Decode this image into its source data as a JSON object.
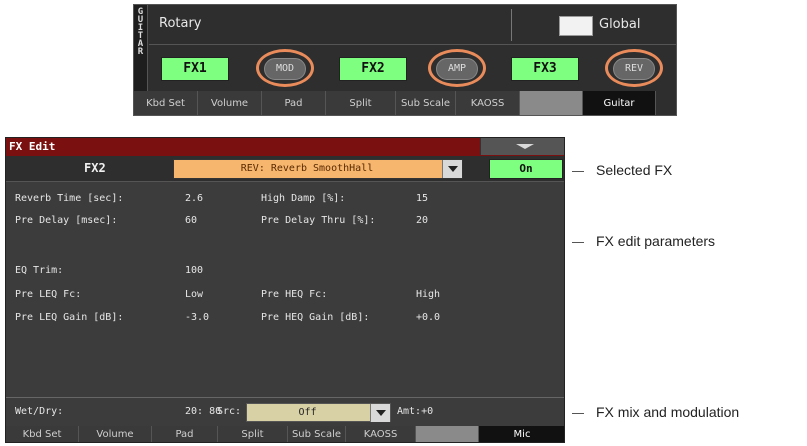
{
  "guitar_panel": {
    "side_label": [
      "G",
      "U",
      "I",
      "T",
      "A",
      "R"
    ],
    "preset": "Rotary",
    "global_label": "Global",
    "fx_buttons": [
      "FX1",
      "FX2",
      "FX3"
    ],
    "mod_buttons": [
      "MOD",
      "AMP",
      "REV"
    ],
    "tabs": [
      "Kbd Set",
      "Volume",
      "Pad",
      "Split",
      "Sub Scale",
      "KAOSS",
      "",
      "Guitar"
    ]
  },
  "fx_edit": {
    "title": "FX Edit",
    "fx_name": "FX2",
    "selected_fx": "REV: Reverb SmoothHall",
    "on_label": "On",
    "params": {
      "reverb_time_label": "Reverb Time [sec]:",
      "reverb_time_value": "2.6",
      "high_damp_label": "High Damp [%]:",
      "high_damp_value": "15",
      "pre_delay_label": "Pre Delay [msec]:",
      "pre_delay_value": "60",
      "pre_delay_thru_label": "Pre Delay Thru [%]:",
      "pre_delay_thru_value": "20",
      "eq_trim_label": "EQ Trim:",
      "eq_trim_value": "100",
      "pre_leq_fc_label": "Pre LEQ Fc:",
      "pre_leq_fc_value": "Low",
      "pre_heq_fc_label": "Pre HEQ Fc:",
      "pre_heq_fc_value": "High",
      "pre_leq_gain_label": "Pre LEQ Gain [dB]:",
      "pre_leq_gain_value": "-3.0",
      "pre_heq_gain_label": "Pre HEQ Gain [dB]:",
      "pre_heq_gain_value": "+0.0"
    },
    "mix": {
      "wet_dry_label": "Wet/Dry:",
      "wet_dry_value": "20: 80",
      "src_label": "Src:",
      "src_value": "Off",
      "amt_label": "Amt:+0"
    },
    "tabs": [
      "Kbd Set",
      "Volume",
      "Pad",
      "Split",
      "Sub Scale",
      "KAOSS",
      "",
      "Mic"
    ]
  },
  "callouts": {
    "selected_fx": "Selected FX",
    "edit_params": "FX edit parameters",
    "mix_mod": "FX mix and modulation"
  },
  "colors": {
    "fx_button_green": "#7fff7f",
    "highlight_ring": "#e98b5a",
    "title_bar_red": "#7a1010",
    "fx_selector_orange": "#f7b66e"
  }
}
